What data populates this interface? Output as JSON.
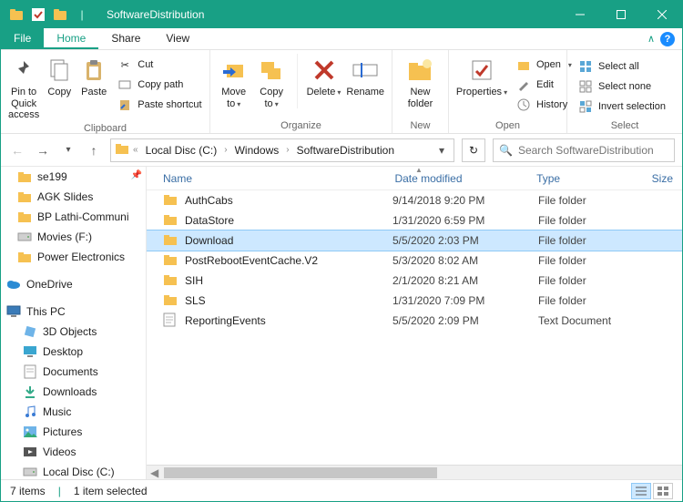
{
  "window": {
    "title": "SoftwareDistribution"
  },
  "tabs": {
    "file": "File",
    "home": "Home",
    "share": "Share",
    "view": "View"
  },
  "ribbon": {
    "pin": "Pin to Quick\naccess",
    "copy": "Copy",
    "paste": "Paste",
    "cut": "Cut",
    "copypath": "Copy path",
    "pasteshortcut": "Paste shortcut",
    "clipboard_group": "Clipboard",
    "moveto": "Move\nto",
    "copyto": "Copy\nto",
    "delete": "Delete",
    "rename": "Rename",
    "organize_group": "Organize",
    "newfolder": "New\nfolder",
    "new_group": "New",
    "properties": "Properties",
    "open": "Open",
    "edit": "Edit",
    "history": "History",
    "open_group": "Open",
    "selectall": "Select all",
    "selectnone": "Select none",
    "invert": "Invert selection",
    "select_group": "Select"
  },
  "breadcrumbs": [
    "Local Disc (C:)",
    "Windows",
    "SoftwareDistribution"
  ],
  "search": {
    "placeholder": "Search SoftwareDistribution"
  },
  "columns": {
    "name": "Name",
    "date": "Date modified",
    "type": "Type",
    "size": "Size"
  },
  "navpane": {
    "top": [
      {
        "label": "se199",
        "icon": "folder"
      },
      {
        "label": "AGK Slides",
        "icon": "folder"
      },
      {
        "label": "BP Lathi-Communi",
        "icon": "folder"
      },
      {
        "label": "Movies (F:)",
        "icon": "drive"
      },
      {
        "label": "Power Electronics",
        "icon": "folder"
      }
    ],
    "onedrive": "OneDrive",
    "thispc": "This PC",
    "pcitems": [
      "3D Objects",
      "Desktop",
      "Documents",
      "Downloads",
      "Music",
      "Pictures",
      "Videos",
      "Local Disc (C:)"
    ]
  },
  "files": [
    {
      "name": "AuthCabs",
      "date": "9/14/2018 9:20 PM",
      "type": "File folder",
      "icon": "folder",
      "selected": false
    },
    {
      "name": "DataStore",
      "date": "1/31/2020 6:59 PM",
      "type": "File folder",
      "icon": "folder",
      "selected": false
    },
    {
      "name": "Download",
      "date": "5/5/2020 2:03 PM",
      "type": "File folder",
      "icon": "folder",
      "selected": true
    },
    {
      "name": "PostRebootEventCache.V2",
      "date": "5/3/2020 8:02 AM",
      "type": "File folder",
      "icon": "folder",
      "selected": false
    },
    {
      "name": "SIH",
      "date": "2/1/2020 8:21 AM",
      "type": "File folder",
      "icon": "folder",
      "selected": false
    },
    {
      "name": "SLS",
      "date": "1/31/2020 7:09 PM",
      "type": "File folder",
      "icon": "folder",
      "selected": false
    },
    {
      "name": "ReportingEvents",
      "date": "5/5/2020 2:09 PM",
      "type": "Text Document",
      "icon": "text",
      "selected": false
    }
  ],
  "status": {
    "count": "7 items",
    "selected": "1 item selected"
  }
}
